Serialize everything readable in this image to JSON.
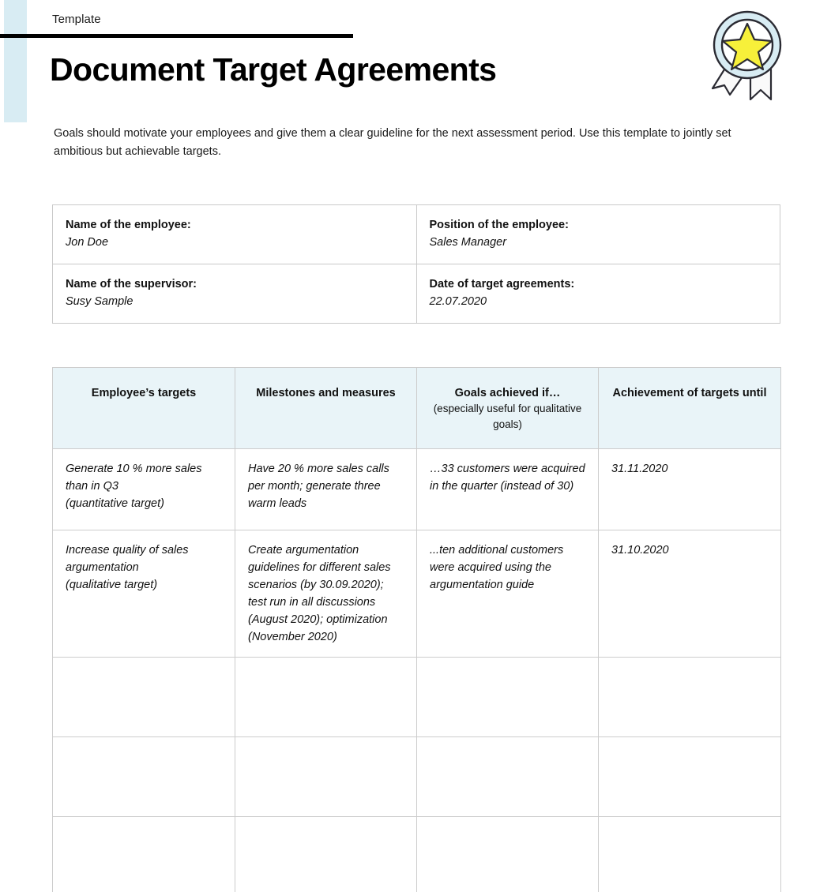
{
  "header": {
    "kicker": "Template",
    "title": "Document Target Agreements",
    "badge_icon": "award-badge-icon",
    "rule_color": "#000000",
    "accent_bar_color": "#d8ecf3"
  },
  "intro": {
    "text": "Goals should motivate your employees and give them a clear guideline for the next assessment period. Use this template to jointly set ambitious but achievable targets."
  },
  "info_table": {
    "rows": [
      [
        {
          "label": "Name of the employee:",
          "value": "Jon Doe"
        },
        {
          "label": "Position of the employee:",
          "value": "Sales Manager"
        }
      ],
      [
        {
          "label": "Name of the supervisor:",
          "value": "Susy Sample"
        },
        {
          "label": "Date of target agreements:",
          "value": "22.07.2020"
        }
      ]
    ]
  },
  "targets_table": {
    "header_bg": "#e9f4f8",
    "columns": [
      {
        "main": "Employee’s targets",
        "sub": ""
      },
      {
        "main": "Milestones and measures",
        "sub": ""
      },
      {
        "main": "Goals achieved if…",
        "sub": "(especially useful for qualitative goals)"
      },
      {
        "main": "Achievement of targets until",
        "sub": ""
      }
    ],
    "rows": [
      {
        "targets": "Generate 10 % more sales than in Q3\n(quantitative target)",
        "milestones": "Have 20 % more sales calls per month; generate three warm leads",
        "achieved_if": "…33 customers were acquired in the quarter (instead of 30)",
        "until": "31.11.2020"
      },
      {
        "targets": "Increase quality of sales argumentation\n(qualitative target)",
        "milestones": "Create argumentation guidelines for different sales scenarios (by 30.09.2020); test run in all discussions (August 2020); optimization (November 2020)",
        "achieved_if": "...ten additional customers were acquired using the argumentation guide",
        "until": "31.10.2020"
      },
      {
        "targets": "",
        "milestones": "",
        "achieved_if": "",
        "until": ""
      },
      {
        "targets": "",
        "milestones": "",
        "achieved_if": "",
        "until": ""
      },
      {
        "targets": "",
        "milestones": "",
        "achieved_if": "",
        "until": ""
      }
    ]
  }
}
